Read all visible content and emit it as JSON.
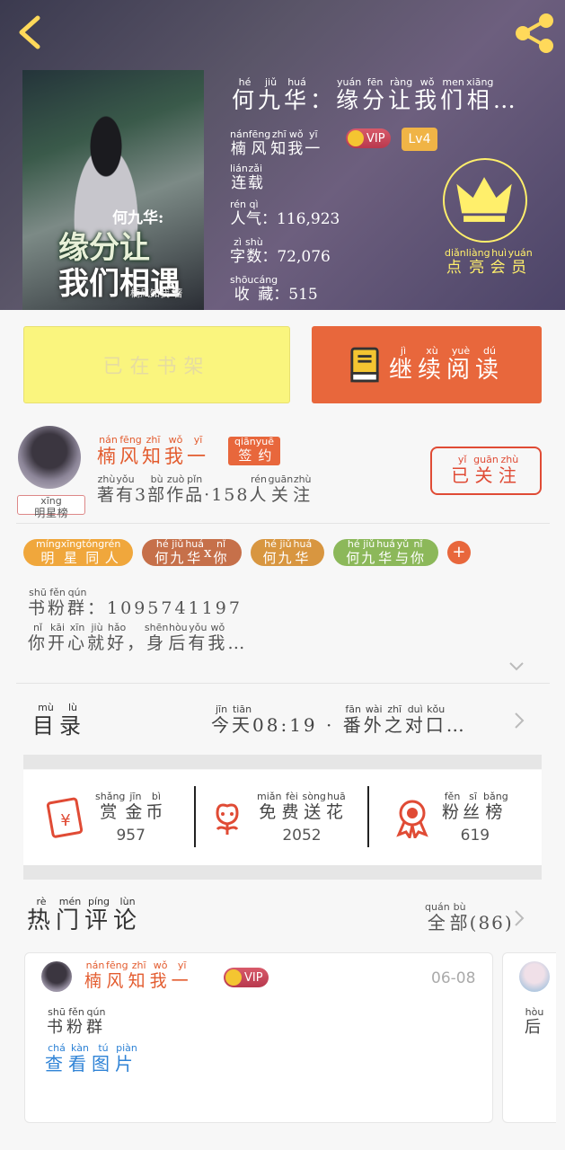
{
  "header": {
    "back_icon": "chevron-left-icon",
    "share_icon": "share-icon",
    "cover": {
      "line1": "何九华:",
      "line2": "缘分让",
      "line3": "我们相遇",
      "byline": "楠风知我 著"
    },
    "title": {
      "chars": [
        {
          "c": "何",
          "p": "hé"
        },
        {
          "c": "九",
          "p": "jiǔ"
        },
        {
          "c": "华",
          "p": "huá"
        },
        {
          "c": "：",
          "p": ""
        },
        {
          "c": "缘",
          "p": "yuán"
        },
        {
          "c": "分",
          "p": "fēn"
        },
        {
          "c": "让",
          "p": "ràng"
        },
        {
          "c": "我",
          "p": "wǒ"
        },
        {
          "c": "们",
          "p": "men"
        },
        {
          "c": "相",
          "p": "xiāng"
        },
        {
          "c": "…",
          "p": ""
        }
      ]
    },
    "author": {
      "chars": [
        {
          "c": "楠",
          "p": "nán"
        },
        {
          "c": "风",
          "p": "fēng"
        },
        {
          "c": "知",
          "p": "zhī"
        },
        {
          "c": "我",
          "p": "wǒ"
        },
        {
          "c": "一",
          "p": "yī"
        }
      ]
    },
    "vip_label": "VIP",
    "level": "Lv4",
    "status": {
      "chars": [
        {
          "c": "连",
          "p": "lián"
        },
        {
          "c": "载",
          "p": "zǎi"
        }
      ]
    },
    "popularity": {
      "chars": [
        {
          "c": "人",
          "p": "rén"
        },
        {
          "c": "气",
          "p": "qì"
        }
      ],
      "value": "：116,923"
    },
    "word_count": {
      "chars": [
        {
          "c": "字",
          "p": "zì"
        },
        {
          "c": "数",
          "p": "shù"
        }
      ],
      "value": "：72,076"
    },
    "favorites": {
      "chars": [
        {
          "c": "收",
          "p": "shōu"
        },
        {
          "c": "藏",
          "p": "cáng"
        }
      ],
      "value": "：515"
    },
    "member_label": {
      "chars": [
        {
          "c": "点",
          "p": "diǎn"
        },
        {
          "c": "亮",
          "p": "liàng"
        },
        {
          "c": "会",
          "p": "huì"
        },
        {
          "c": "员",
          "p": "yuán"
        }
      ]
    }
  },
  "actions": {
    "in_shelf": "已在书架",
    "continue_read": {
      "chars": [
        {
          "c": "继",
          "p": "jì"
        },
        {
          "c": "续",
          "p": "xù"
        },
        {
          "c": "阅",
          "p": "yuè"
        },
        {
          "c": "读",
          "p": "dú"
        }
      ]
    }
  },
  "author_section": {
    "badge": {
      "chars": [
        {
          "c": "明",
          "p": ""
        },
        {
          "c": "星",
          "p": "xīng"
        },
        {
          "c": "榜",
          "p": ""
        }
      ]
    },
    "name": {
      "chars": [
        {
          "c": "楠",
          "p": "nán"
        },
        {
          "c": "风",
          "p": "fēng"
        },
        {
          "c": "知",
          "p": "zhī"
        },
        {
          "c": "我",
          "p": "wǒ"
        },
        {
          "c": "一",
          "p": "yī"
        }
      ]
    },
    "signed": {
      "chars": [
        {
          "c": "签",
          "p": "qiān"
        },
        {
          "c": "约",
          "p": "yuē"
        }
      ]
    },
    "info": {
      "chars": [
        {
          "c": "著",
          "p": "zhù"
        },
        {
          "c": "有",
          "p": "yǒu"
        },
        {
          "c": "3",
          "p": ""
        },
        {
          "c": "部",
          "p": "bù"
        },
        {
          "c": "作",
          "p": "zuò"
        },
        {
          "c": "品",
          "p": "pǐn"
        },
        {
          "c": "·158",
          "p": ""
        },
        {
          "c": "人",
          "p": "rén"
        },
        {
          "c": "关",
          "p": "guān"
        },
        {
          "c": "注",
          "p": "zhù"
        }
      ]
    },
    "follow": {
      "chars": [
        {
          "c": "已",
          "p": "yǐ"
        },
        {
          "c": "关",
          "p": "guān"
        },
        {
          "c": "注",
          "p": "zhù"
        }
      ]
    }
  },
  "tags": [
    {
      "color": "#f0a73c",
      "chars": [
        {
          "c": "明",
          "p": "míng"
        },
        {
          "c": "星",
          "p": "xīng"
        },
        {
          "c": "同",
          "p": "tóng"
        },
        {
          "c": "人",
          "p": "rén"
        }
      ]
    },
    {
      "color": "#c6704a",
      "chars": [
        {
          "c": "何",
          "p": "hé"
        },
        {
          "c": "九",
          "p": "jiǔ"
        },
        {
          "c": "华",
          "p": "huá"
        },
        {
          "c": "x",
          "p": ""
        },
        {
          "c": "你",
          "p": "nǐ"
        }
      ]
    },
    {
      "color": "#d89640",
      "chars": [
        {
          "c": "何",
          "p": "hé"
        },
        {
          "c": "九",
          "p": "jiǔ"
        },
        {
          "c": "华",
          "p": "huá"
        }
      ]
    },
    {
      "color": "#8cb85a",
      "chars": [
        {
          "c": "何",
          "p": "hé"
        },
        {
          "c": "九",
          "p": "jiǔ"
        },
        {
          "c": "华",
          "p": "huá"
        },
        {
          "c": "与",
          "p": "yǔ"
        },
        {
          "c": "你",
          "p": "nǐ"
        }
      ]
    }
  ],
  "tag_add": "+",
  "description": {
    "line1": {
      "chars": [
        {
          "c": "书",
          "p": "shū"
        },
        {
          "c": "粉",
          "p": "fěn"
        },
        {
          "c": "群",
          "p": "qún"
        },
        {
          "c": "：1095741197",
          "p": ""
        }
      ]
    },
    "line2": {
      "chars": [
        {
          "c": "你",
          "p": "nǐ"
        },
        {
          "c": "开",
          "p": "kāi"
        },
        {
          "c": "心",
          "p": "xīn"
        },
        {
          "c": "就",
          "p": "jiù"
        },
        {
          "c": "好",
          "p": "hǎo"
        },
        {
          "c": "，",
          "p": ""
        },
        {
          "c": "身",
          "p": "shēn"
        },
        {
          "c": "后",
          "p": "hòu"
        },
        {
          "c": "有",
          "p": "yǒu"
        },
        {
          "c": "我",
          "p": "wǒ"
        },
        {
          "c": "…",
          "p": ""
        }
      ]
    }
  },
  "toc": {
    "label": {
      "chars": [
        {
          "c": "目",
          "p": "mù"
        },
        {
          "c": "录",
          "p": "lù"
        }
      ]
    },
    "update": {
      "chars": [
        {
          "c": "今",
          "p": "jīn"
        },
        {
          "c": "天",
          "p": "tiān"
        },
        {
          "c": "08:19 · ",
          "p": ""
        },
        {
          "c": "番",
          "p": "fān"
        },
        {
          "c": "外",
          "p": "wài"
        },
        {
          "c": "之",
          "p": "zhī"
        },
        {
          "c": "对",
          "p": "duì"
        },
        {
          "c": "口",
          "p": "kǒu"
        },
        {
          "c": "…",
          "p": ""
        }
      ]
    }
  },
  "support": [
    {
      "icon": "red-envelope-icon",
      "chars": [
        {
          "c": "赏",
          "p": "shǎng"
        },
        {
          "c": "金",
          "p": "jīn"
        },
        {
          "c": "币",
          "p": "bì"
        }
      ],
      "value": "957"
    },
    {
      "icon": "flower-icon",
      "chars": [
        {
          "c": "免",
          "p": "miǎn"
        },
        {
          "c": "费",
          "p": "fèi"
        },
        {
          "c": "送",
          "p": "sòng"
        },
        {
          "c": "花",
          "p": "huā"
        }
      ],
      "value": "2052"
    },
    {
      "icon": "medal-icon",
      "chars": [
        {
          "c": "粉",
          "p": "fěn"
        },
        {
          "c": "丝",
          "p": "sī"
        },
        {
          "c": "榜",
          "p": "bǎng"
        }
      ],
      "value": "619"
    }
  ],
  "comments": {
    "title": {
      "chars": [
        {
          "c": "热",
          "p": "rè"
        },
        {
          "c": "门",
          "p": "mén"
        },
        {
          "c": "评",
          "p": "píng"
        },
        {
          "c": "论",
          "p": "lùn"
        }
      ]
    },
    "all": {
      "chars": [
        {
          "c": "全",
          "p": "quán"
        },
        {
          "c": "部",
          "p": "bù"
        },
        {
          "c": "(86)",
          "p": ""
        }
      ]
    },
    "items": [
      {
        "user": {
          "chars": [
            {
              "c": "楠",
              "p": "nán"
            },
            {
              "c": "风",
              "p": "fēng"
            },
            {
              "c": "知",
              "p": "zhī"
            },
            {
              "c": "我",
              "p": "wǒ"
            },
            {
              "c": "一",
              "p": "yī"
            }
          ]
        },
        "vip": "VIP",
        "date": "06-08",
        "text": {
          "chars": [
            {
              "c": "书",
              "p": "shū"
            },
            {
              "c": "粉",
              "p": "fěn"
            },
            {
              "c": "群",
              "p": "qún"
            }
          ]
        },
        "link": {
          "chars": [
            {
              "c": "查",
              "p": "chá"
            },
            {
              "c": "看",
              "p": "kàn"
            },
            {
              "c": "图",
              "p": "tú"
            },
            {
              "c": "片",
              "p": "piàn"
            }
          ]
        }
      },
      {
        "text": {
          "chars": [
            {
              "c": "后",
              "p": "hòu"
            }
          ]
        }
      }
    ]
  },
  "colors": {
    "accent_orange": "#e8673c",
    "author_red": "#e35c2f",
    "member_yellow": "#ffef6b",
    "shelf_yellow": "#faf57e",
    "link_blue": "#2f83d6"
  }
}
